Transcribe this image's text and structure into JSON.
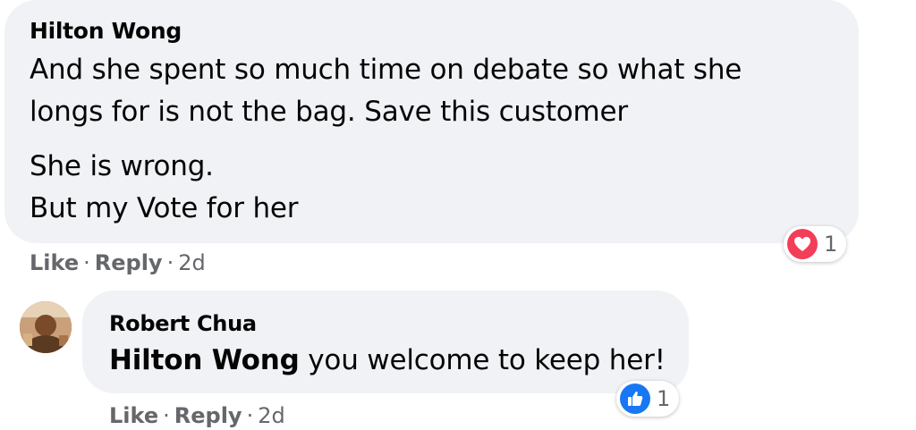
{
  "comment1": {
    "author": "Hilton Wong",
    "paragraph1_line1": "And she spent so much time on debate so what she",
    "paragraph1_line2": "longs for is not the bag. Save this customer",
    "paragraph2_line1": "She is wrong.",
    "paragraph2_line2": "But my Vote for her",
    "like_label": "Like",
    "reply_label": "Reply",
    "separator": "·",
    "time": "2d",
    "reaction": {
      "icon": "heart-icon",
      "color": "#f33e58",
      "count": "1"
    }
  },
  "comment2": {
    "author": "Robert Chua",
    "mention": "Hilton Wong",
    "text": " you welcome to keep her!",
    "like_label": "Like",
    "reply_label": "Reply",
    "separator": "·",
    "time": "2d",
    "reaction": {
      "icon": "thumbs-up-icon",
      "color": "#1877f2",
      "count": "1"
    }
  }
}
